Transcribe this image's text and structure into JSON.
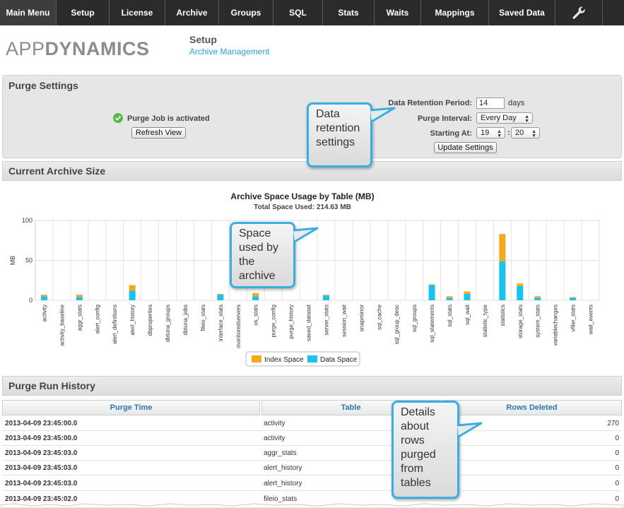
{
  "nav": {
    "items": [
      "Main Menu",
      "Setup",
      "License",
      "Archive",
      "Groups",
      "SQL",
      "Stats",
      "Waits",
      "Mappings",
      "Saved Data"
    ],
    "tools_icon": "wrench-icon"
  },
  "header": {
    "logo_part1": "APP",
    "logo_part2": "DYNAMICS",
    "title": "Setup",
    "subtitle": "Archive Management"
  },
  "purge_settings": {
    "title": "Purge Settings",
    "status_text": "Purge Job is activated",
    "status_icon": "check-circle-icon",
    "refresh_label": "Refresh View",
    "retention_label": "Data Retention Period:",
    "retention_value": "14",
    "retention_unit": "days",
    "interval_label": "Purge Interval:",
    "interval_value": "Every Day",
    "starting_label": "Starting At:",
    "start_hour": "19",
    "start_minute": "20",
    "time_sep": ":",
    "update_label": "Update Settings"
  },
  "callouts": {
    "retention": "Data retention settings",
    "space": "Space used by the archive",
    "details": "Details about rows purged from tables"
  },
  "archive_size": {
    "title": "Current Archive Size"
  },
  "chart_data": {
    "type": "bar",
    "stacked": true,
    "title": "Archive Space Usage by Table (MB)",
    "subtitle": "Total Space Used: 214.63 MB",
    "ylabel": "MB",
    "ylim": [
      0,
      100
    ],
    "yticks": [
      0,
      50,
      100
    ],
    "grid": true,
    "legend_position": "bottom",
    "categories": [
      "activity",
      "activity_baseline",
      "aggr_stats",
      "alert_config",
      "alert_definitions",
      "alert_history",
      "dbproperties",
      "dbtuna_groups",
      "dbtuna_jobs",
      "fileio_stats",
      "interface_stats",
      "monitoredservers",
      "os_stats",
      "purge_config",
      "purge_history",
      "saved_dataset",
      "server_stats",
      "session_wait",
      "snapmirror",
      "sql_cache",
      "sql_group_desc",
      "sql_groups",
      "sql_statements",
      "sql_stats",
      "sql_wait",
      "statistic_type",
      "statistics",
      "storage_stats",
      "system_stats",
      "variablechanges",
      "vfiler_stats",
      "wait_events"
    ],
    "series": [
      {
        "name": "Data Space",
        "color": "#19c3f0",
        "values": [
          5,
          0,
          4,
          0,
          0,
          12,
          0,
          0,
          0,
          0,
          7,
          0,
          5,
          0,
          0,
          0,
          6,
          0,
          0,
          0,
          0,
          0,
          19,
          3,
          8,
          0,
          49,
          18,
          3,
          0,
          3,
          0
        ]
      },
      {
        "name": "Index Space",
        "color": "#f5a81b",
        "values": [
          2,
          0,
          3,
          0,
          0,
          7,
          0,
          0,
          0,
          0,
          1,
          0,
          4,
          0,
          0,
          0,
          1,
          0,
          0,
          0,
          0,
          0,
          1,
          2,
          3,
          0,
          34,
          3,
          2,
          0,
          1,
          0
        ]
      }
    ]
  },
  "run_history": {
    "title": "Purge Run History",
    "columns": [
      "Purge Time",
      "Table",
      "Rows Deleted"
    ],
    "rows": [
      [
        "2013-04-09 23:45:00.0",
        "activity",
        "270"
      ],
      [
        "2013-04-09 23:45:00.0",
        "activity",
        "0"
      ],
      [
        "2013-04-09 23:45:03.0",
        "aggr_stats",
        "0"
      ],
      [
        "2013-04-09 23:45:03.0",
        "alert_history",
        "0"
      ],
      [
        "2013-04-09 23:45:03.0",
        "alert_history",
        "0"
      ],
      [
        "2013-04-09 23:45:02.0",
        "fileio_stats",
        "0"
      ]
    ]
  }
}
